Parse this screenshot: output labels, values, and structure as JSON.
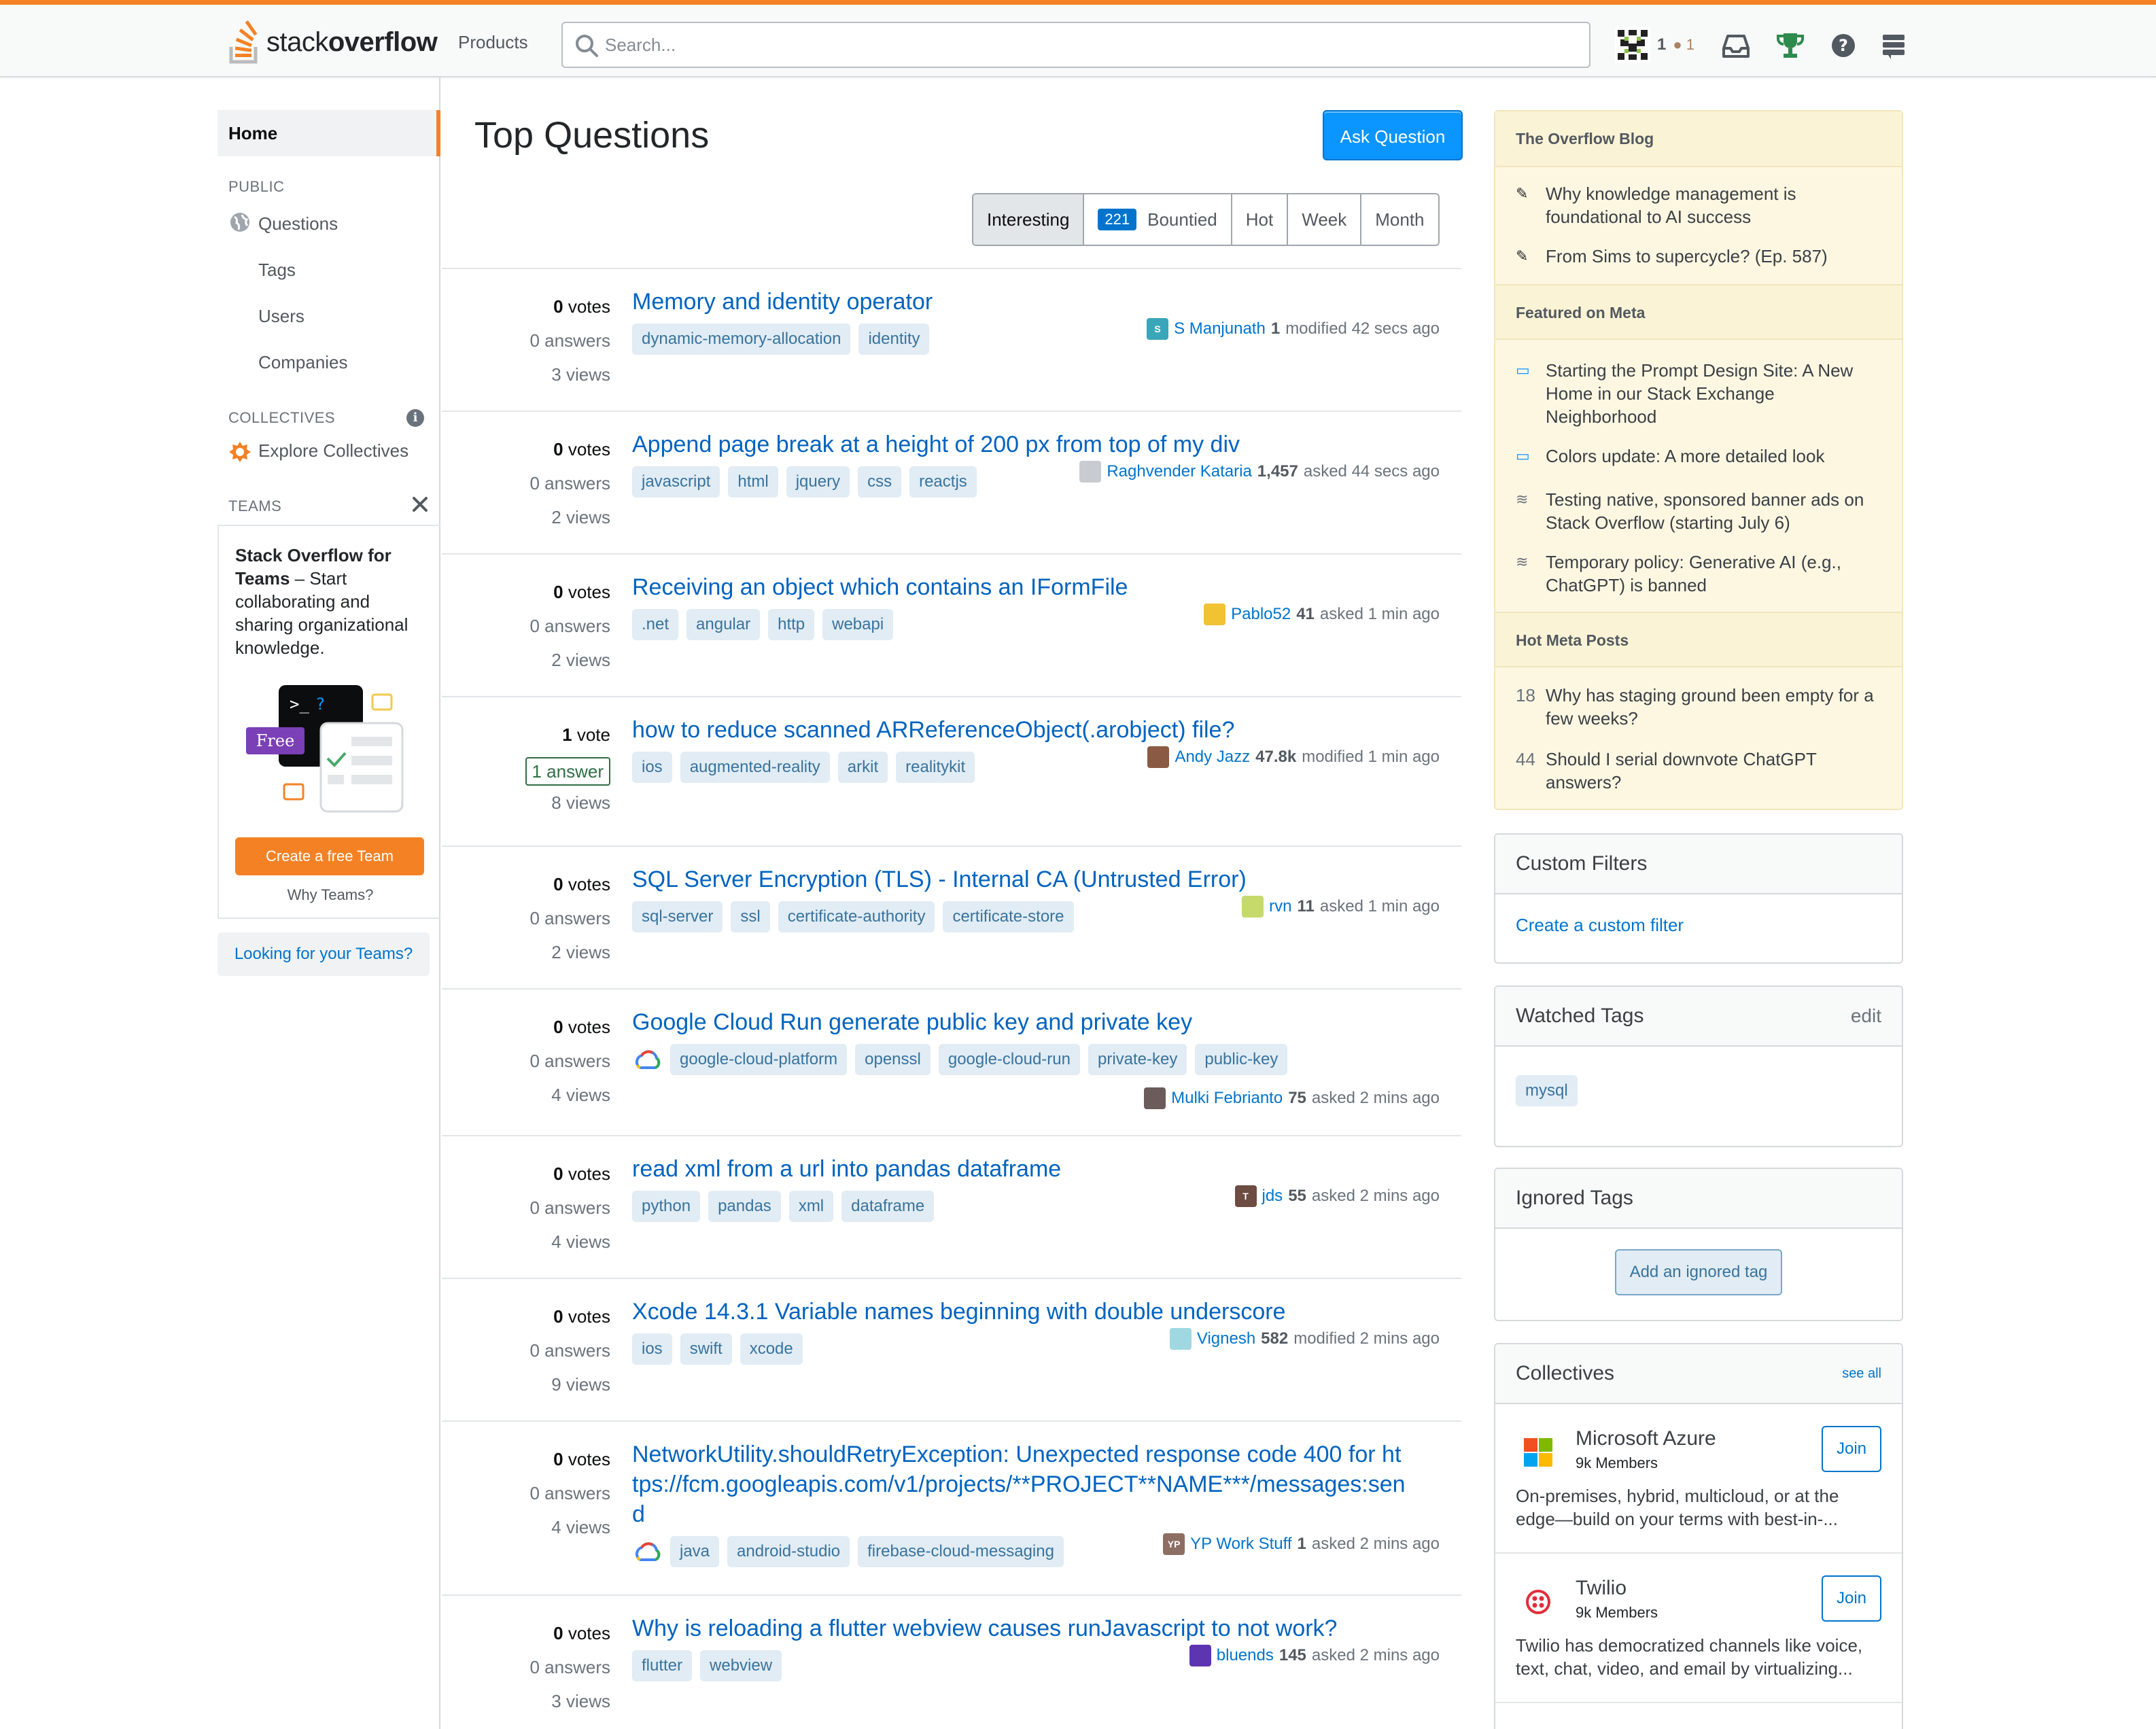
{
  "header": {
    "logo_text_light": "stack",
    "logo_text_bold": "overflow",
    "products": "Products",
    "search_placeholder": "Search...",
    "user_rep": "1",
    "user_bronze": "● 1",
    "accent": "#f48225"
  },
  "leftnav": {
    "home": "Home",
    "public_label": "PUBLIC",
    "questions": "Questions",
    "tags": "Tags",
    "users": "Users",
    "companies": "Companies",
    "collectives_label": "COLLECTIVES",
    "explore_collectives": "Explore Collectives",
    "teams_label": "TEAMS",
    "teams_promo_bold": "Stack Overflow for Teams",
    "teams_promo_rest": " – Start collaborating and sharing organizational knowledge.",
    "free_badge": "Free",
    "prompt": ">_?",
    "create_team": "Create a free Team",
    "why_teams": "Why Teams?",
    "looking_teams": "Looking for your Teams?"
  },
  "main": {
    "title": "Top Questions",
    "ask_button": "Ask Question",
    "filters": {
      "interesting": "Interesting",
      "bountied_count": "221",
      "bountied": "Bountied",
      "hot": "Hot",
      "week": "Week",
      "month": "Month"
    }
  },
  "questions": [
    {
      "votes": "0",
      "votes_label": "votes",
      "answers": "0 answers",
      "views": "3 views",
      "title": "Memory and identity operator",
      "tags": [
        "dynamic-memory-allocation",
        "identity"
      ],
      "user": "S Manjunath",
      "rep": "1",
      "action": "modified 42 secs ago",
      "avatar_color": "#3aa6b9",
      "avatar_letter": "S"
    },
    {
      "votes": "0",
      "votes_label": "votes",
      "answers": "0 answers",
      "views": "2 views",
      "title": "Append page break at a height of 200 px from top of my div",
      "tags": [
        "javascript",
        "html",
        "jquery",
        "css",
        "reactjs"
      ],
      "user": "Raghvender Kataria",
      "rep": "1,457",
      "action": "asked 44 secs ago",
      "avatar_color": "#c8ccd0",
      "avatar_letter": ""
    },
    {
      "votes": "0",
      "votes_label": "votes",
      "answers": "0 answers",
      "views": "2 views",
      "title": "Receiving an object which contains an IFormFile",
      "tags": [
        ".net",
        "angular",
        "http",
        "webapi"
      ],
      "user": "Pablo52",
      "rep": "41",
      "action": "asked 1 min ago",
      "avatar_color": "#f1c232",
      "avatar_letter": ""
    },
    {
      "votes": "1",
      "votes_label": "vote",
      "answers": "1 answer",
      "views": "8 views",
      "title": "how to reduce scanned ARReferenceObject(.arobject) file?",
      "tags": [
        "ios",
        "augmented-reality",
        "arkit",
        "realitykit"
      ],
      "user": "Andy Jazz",
      "rep": "47.8k",
      "action": "modified 1 min ago",
      "avatar_color": "#8a5a44",
      "avatar_letter": ""
    },
    {
      "votes": "0",
      "votes_label": "votes",
      "answers": "0 answers",
      "views": "2 views",
      "title": "SQL Server Encryption (TLS) - Internal CA (Untrusted Error)",
      "tags": [
        "sql-server",
        "ssl",
        "certificate-authority",
        "certificate-store"
      ],
      "user": "rvn",
      "rep": "11",
      "action": "asked 1 min ago",
      "avatar_color": "#c6d96b",
      "avatar_letter": ""
    },
    {
      "votes": "0",
      "votes_label": "votes",
      "answers": "0 answers",
      "views": "4 views",
      "title": "Google Cloud Run generate public key and private key",
      "tags": [
        "google-cloud-platform",
        "openssl",
        "google-cloud-run",
        "private-key",
        "public-key"
      ],
      "user": "Mulki Febrianto",
      "rep": "75",
      "action": "asked 2 mins ago",
      "avatar_color": "#6b5b5b",
      "avatar_letter": ""
    },
    {
      "votes": "0",
      "votes_label": "votes",
      "answers": "0 answers",
      "views": "4 views",
      "title": "read xml from a url into pandas dataframe",
      "tags": [
        "python",
        "pandas",
        "xml",
        "dataframe"
      ],
      "user": "jds",
      "rep": "55",
      "action": "asked 2 mins ago",
      "avatar_color": "#6d4c41",
      "avatar_letter": "T"
    },
    {
      "votes": "0",
      "votes_label": "votes",
      "answers": "0 answers",
      "views": "9 views",
      "title": "Xcode 14.3.1 Variable names beginning with double underscore",
      "tags": [
        "ios",
        "swift",
        "xcode"
      ],
      "user": "Vignesh",
      "rep": "582",
      "action": "modified 2 mins ago",
      "avatar_color": "#9fd8e0",
      "avatar_letter": ""
    },
    {
      "votes": "0",
      "votes_label": "votes",
      "answers": "0 answers",
      "views": "4 views",
      "title": "NetworkUtility.shouldRetryException: Unexpected response code 400 for https://fcm.googleapis.com/v1/projects/**PROJECT**NAME***/messages:send",
      "tags": [
        "java",
        "android-studio",
        "firebase-cloud-messaging"
      ],
      "user": "YP Work Stuff",
      "rep": "1",
      "action": "asked 2 mins ago",
      "avatar_color": "#8d6e63",
      "avatar_letter": "YP"
    },
    {
      "votes": "0",
      "votes_label": "votes",
      "answers": "0 answers",
      "views": "3 views",
      "title": "Why is reloading a flutter webview causes runJavascript to not work?",
      "tags": [
        "flutter",
        "webview"
      ],
      "user": "bluends",
      "rep": "145",
      "action": "asked 2 mins ago",
      "avatar_color": "#5e35b1",
      "avatar_letter": ""
    }
  ],
  "right": {
    "blog_title": "The Overflow Blog",
    "blog_items": [
      "Why knowledge management is foundational to AI success",
      "From Sims to supercycle? (Ep. 587)"
    ],
    "meta_title": "Featured on Meta",
    "meta_items": [
      "Starting the Prompt Design Site: A New Home in our Stack Exchange Neighborhood",
      "Colors update: A more detailed look",
      "Testing native, sponsored banner ads on Stack Overflow (starting July 6)",
      "Temporary policy: Generative AI (e.g., ChatGPT) is banned"
    ],
    "hot_title": "Hot Meta Posts",
    "hot_items": [
      {
        "count": "18",
        "text": "Why has staging ground been empty for a few weeks?"
      },
      {
        "count": "44",
        "text": "Should I serial downvote ChatGPT answers?"
      }
    ],
    "custom_filters_title": "Custom Filters",
    "create_filter": "Create a custom filter",
    "watched_title": "Watched Tags",
    "watched_edit": "edit",
    "watched_tag": "mysql",
    "ignored_title": "Ignored Tags",
    "add_ignored": "Add an ignored tag",
    "collectives_title": "Collectives",
    "see_all": "see all",
    "collectives": [
      {
        "name": "Microsoft Azure",
        "members": "9k Members",
        "desc": "On-premises, hybrid, multicloud, or at the edge—build on your terms with best-in-...",
        "join": "Join"
      },
      {
        "name": "Twilio",
        "members": "9k Members",
        "desc": "Twilio has democratized channels like voice, text, chat, video, and email by virtualizing...",
        "join": "Join"
      }
    ]
  }
}
